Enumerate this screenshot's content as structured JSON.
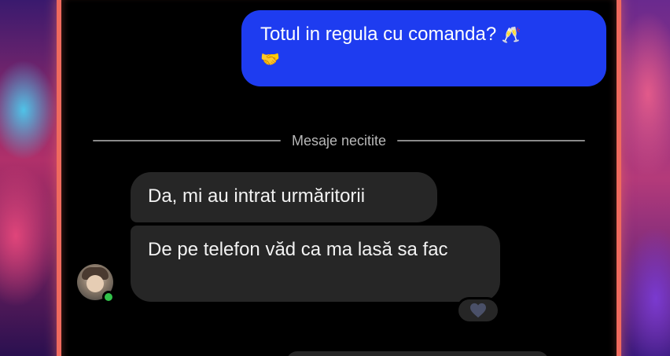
{
  "messages": {
    "outgoing": {
      "text": "Totul in regula cu comanda?",
      "emoji_glasses": "🥂",
      "emoji_handshake": "🤝"
    },
    "unread_divider_label": "Mesaje necitite",
    "incoming": [
      {
        "text": "Da, mi au intrat urmăritorii"
      },
      {
        "text": "De pe telefon văd ca ma lasă sa fac"
      }
    ],
    "reaction": "heart-icon"
  },
  "colors": {
    "outgoing_bubble": "#1e3cf0",
    "incoming_bubble": "#262626",
    "online_indicator": "#32c24a",
    "frame_accent": "#f06a5e"
  }
}
